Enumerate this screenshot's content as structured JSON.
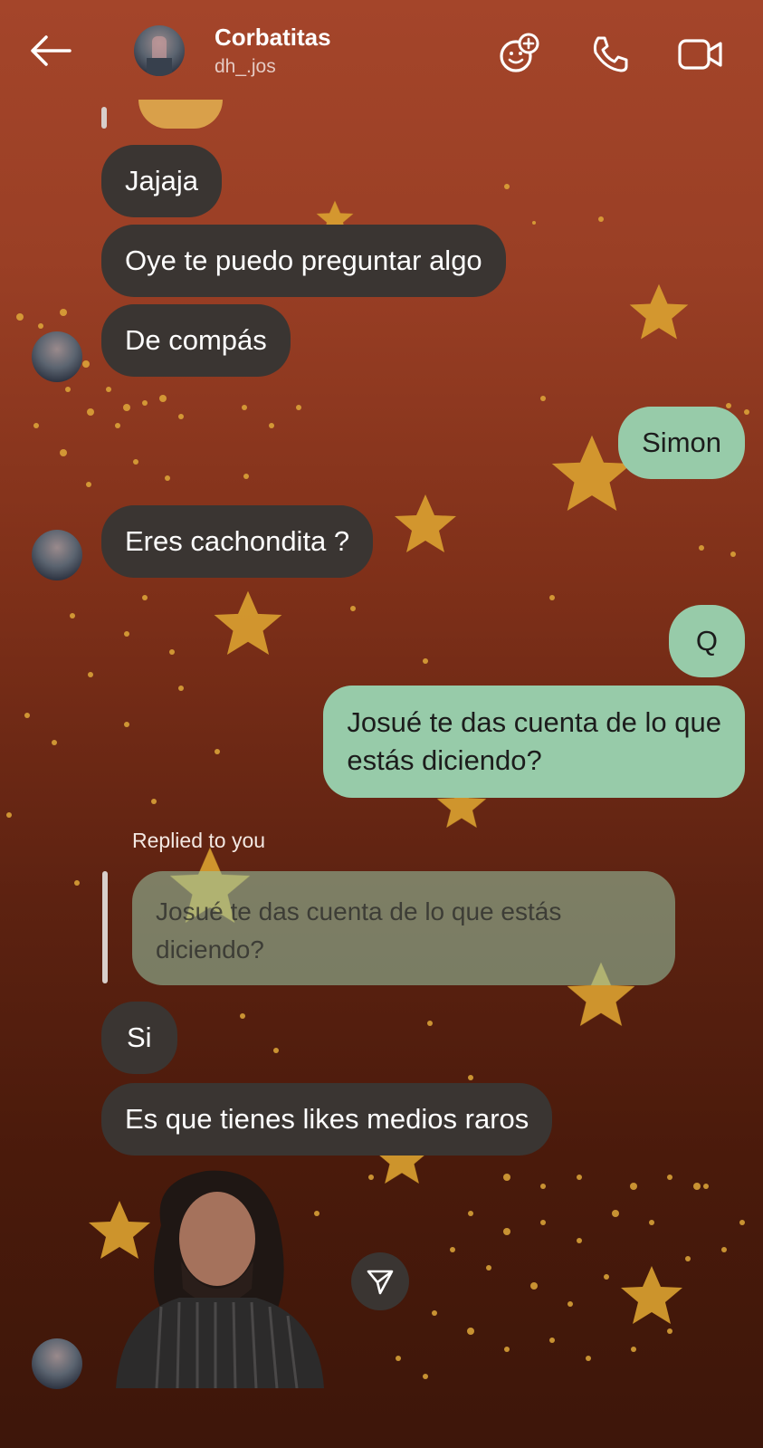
{
  "header": {
    "name": "Corbatitas",
    "handle": "dh_.jos"
  },
  "messages": {
    "m1": "Jajaja",
    "m2": "Oye te puedo preguntar algo",
    "m3": "De compás",
    "m4": "Simon",
    "m5": "Eres cachondita ?",
    "m6": "Q",
    "m7_line1": "Josué te das cuenta de lo que",
    "m7_line2": "estás diciendo?",
    "reply_label": "Replied to you",
    "reply_quote": "Josué te das cuenta de lo que estás diciendo?",
    "m8": "Si",
    "m9": "Es que tienes likes medios raros"
  },
  "colors": {
    "incoming_bubble": "#3a3532",
    "outgoing_bubble": "#97cba9",
    "background_top": "#a4452a",
    "background_bottom": "#3d160a"
  },
  "icons": {
    "back": "arrow-left-icon",
    "effects": "effects-icon",
    "call": "phone-icon",
    "video": "video-camera-icon",
    "send": "send-icon"
  }
}
